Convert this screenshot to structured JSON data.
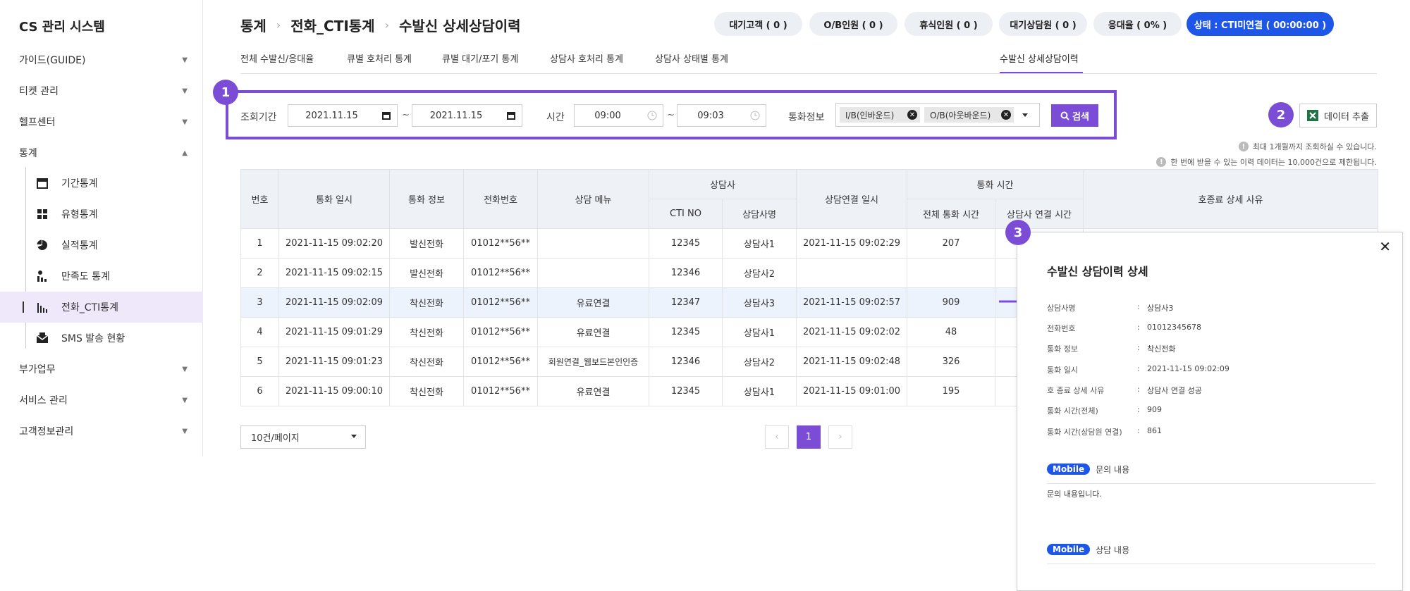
{
  "app_title": "CS 관리 시스템",
  "sidebar": {
    "items": [
      {
        "label": "가이드(GUIDE)"
      },
      {
        "label": "티켓 관리"
      },
      {
        "label": "헬프센터"
      },
      {
        "label": "통계"
      },
      {
        "label": "부가업무"
      },
      {
        "label": "서비스 관리"
      },
      {
        "label": "고객정보관리"
      }
    ],
    "sub_items": [
      {
        "label": "기간통계",
        "icon": "calendar-icon"
      },
      {
        "label": "유형통계",
        "icon": "grid-icon"
      },
      {
        "label": "실적통계",
        "icon": "pie-icon"
      },
      {
        "label": "만족도 통계",
        "icon": "survey-icon"
      },
      {
        "label": "전화_CTI통계",
        "icon": "bar-chart-icon"
      },
      {
        "label": "SMS 발송 현황",
        "icon": "mail-icon"
      }
    ]
  },
  "breadcrumb": [
    "통계",
    "전화_CTI통계",
    "수발신 상세상담이력"
  ],
  "status": [
    "대기고객 ( 0 )",
    "O/B인원 ( 0 )",
    "휴식인원 ( 0 )",
    "대기상담원 ( 0 )",
    "응대율 ( 0% )",
    "상태 : CTI미연결 ( 00:00:00 )"
  ],
  "tabs": [
    "전체 수발신/응대율",
    "큐별 호처리 통계",
    "큐별 대기/포기 통계",
    "상담사 호처리 통계",
    "상담사 상태별 통계",
    "수발신 상세상담이력"
  ],
  "badges": [
    "1",
    "2",
    "3"
  ],
  "filter": {
    "period_label": "조회기간",
    "date_from": "2021.11.15",
    "date_to": "2021.11.15",
    "tilde": "~",
    "time_label": "시간",
    "time_from": "09:00",
    "time_to": "09:03",
    "call_label": "통화정보",
    "tags": [
      "I/B(인바운드)",
      "O/B(아웃바운드)"
    ],
    "search": "검색"
  },
  "export_label": "데이터 추출",
  "notices": [
    "최대 1개월까지 조회하실 수 있습니다.",
    "한 번에 받을 수 있는 이력 데이터는 10,000건으로 제한됩니다."
  ],
  "table": {
    "headers": {
      "no": "번호",
      "time": "통화 일시",
      "info": "통화 정보",
      "phone": "전화번호",
      "menu": "상담 메뉴",
      "agent_group": "상담사",
      "cti": "CTI NO",
      "agent": "상담사명",
      "connect_time": "상담연결 일시",
      "call_group": "통화 시간",
      "total": "전체 통화 시간",
      "agent_time": "상담사 연결 시간",
      "reason": "호종료 상세 사유"
    },
    "rows": [
      [
        "1",
        "2021-11-15 09:02:20",
        "발신전화",
        "01012**56**",
        "",
        "12345",
        "상담사1",
        "2021-11-15 09:02:29",
        "207"
      ],
      [
        "2",
        "2021-11-15 09:02:15",
        "발신전화",
        "01012**56**",
        "",
        "12346",
        "상담사2",
        "",
        ""
      ],
      [
        "3",
        "2021-11-15 09:02:09",
        "착신전화",
        "01012**56**",
        "유료연결",
        "12347",
        "상담사3",
        "2021-11-15 09:02:57",
        "909"
      ],
      [
        "4",
        "2021-11-15 09:01:29",
        "착신전화",
        "01012**56**",
        "유료연결",
        "12345",
        "상담사1",
        "2021-11-15 09:02:02",
        "48"
      ],
      [
        "5",
        "2021-11-15 09:01:23",
        "착신전화",
        "01012**56**",
        "회원연결_웹보드본인인증",
        "12346",
        "상담사2",
        "2021-11-15 09:02:48",
        "326"
      ],
      [
        "6",
        "2021-11-15 09:00:10",
        "착신전화",
        "01012**56**",
        "유료연결",
        "12345",
        "상담사1",
        "2021-11-15 09:01:00",
        "195"
      ]
    ]
  },
  "pager": {
    "page_size": "10건/페이지",
    "prev": "‹",
    "current": "1",
    "next": "›"
  },
  "panel": {
    "title": "수발신 상담이력 상세",
    "close": "✕",
    "colon": ":",
    "rows": [
      [
        "상담사명",
        "상담사3"
      ],
      [
        "전화번호",
        "01012345678"
      ],
      [
        "통화 정보",
        "착신전화"
      ],
      [
        "통화 일시",
        "2021-11-15 09:02:09"
      ],
      [
        "호 종료 상세 사유",
        "상담사 연결 성공"
      ],
      [
        "통화 시간(전체)",
        "909"
      ],
      [
        "통화 시간(상담원 연결)",
        "861"
      ]
    ],
    "mobile": "Mobile",
    "inquiry_label": "문의 내용",
    "inquiry_text": "문의 내용입니다.",
    "consult_label": "상담 내용"
  },
  "colors": {
    "accent": "#7b4dd6",
    "blue": "#1e56e8"
  }
}
